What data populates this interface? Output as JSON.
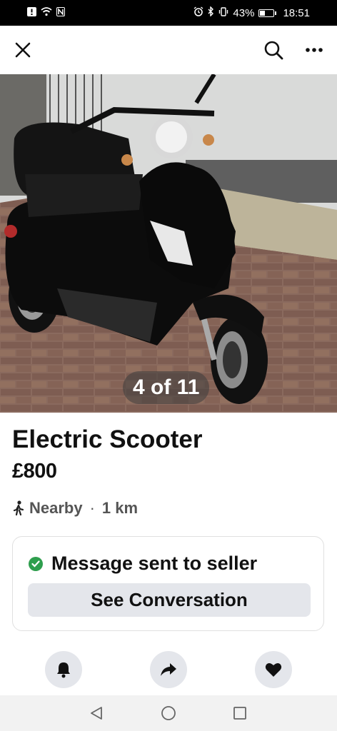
{
  "status_bar": {
    "battery_percent": "43%",
    "battery_level": 0.43,
    "time": "18:51",
    "left_icons": [
      "notification-icon",
      "wifi-icon",
      "nfc-icon"
    ],
    "right_icons": [
      "alarm-icon",
      "bluetooth-icon",
      "vibrate-icon",
      "battery-icon"
    ]
  },
  "topbar": {
    "left_icon": "close-icon",
    "right_icons": [
      "search-icon",
      "more-icon"
    ]
  },
  "gallery": {
    "counter": "4 of 11"
  },
  "listing": {
    "title": "Electric Scooter",
    "price": "£800",
    "location_label": "Nearby",
    "separator": "·",
    "distance": "1 km"
  },
  "message": {
    "status_text": "Message sent to seller",
    "button_label": "See Conversation"
  },
  "actions": [
    "bell-icon",
    "share-icon",
    "heart-icon"
  ],
  "nav": [
    "back-icon",
    "home-icon",
    "recents-icon"
  ],
  "colors": {
    "check_green": "#2e9e4d",
    "button_grey": "#e4e6eb"
  }
}
